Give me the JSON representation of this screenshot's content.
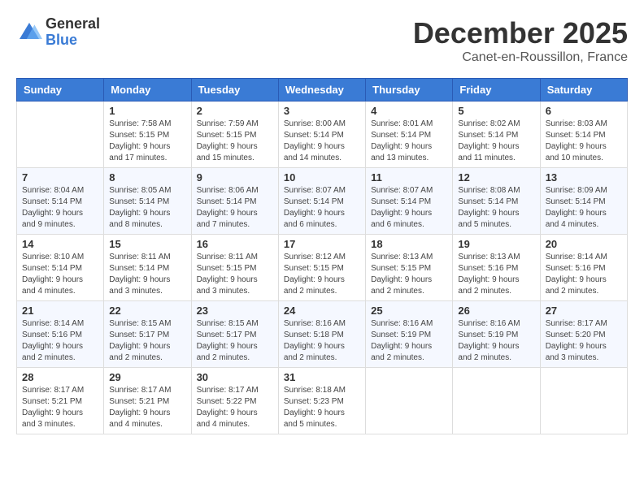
{
  "logo": {
    "general": "General",
    "blue": "Blue"
  },
  "title": "December 2025",
  "location": "Canet-en-Roussillon, France",
  "days_of_week": [
    "Sunday",
    "Monday",
    "Tuesday",
    "Wednesday",
    "Thursday",
    "Friday",
    "Saturday"
  ],
  "weeks": [
    [
      {
        "day": "",
        "sunrise": "",
        "sunset": "",
        "daylight": ""
      },
      {
        "day": "1",
        "sunrise": "Sunrise: 7:58 AM",
        "sunset": "Sunset: 5:15 PM",
        "daylight": "Daylight: 9 hours and 17 minutes."
      },
      {
        "day": "2",
        "sunrise": "Sunrise: 7:59 AM",
        "sunset": "Sunset: 5:15 PM",
        "daylight": "Daylight: 9 hours and 15 minutes."
      },
      {
        "day": "3",
        "sunrise": "Sunrise: 8:00 AM",
        "sunset": "Sunset: 5:14 PM",
        "daylight": "Daylight: 9 hours and 14 minutes."
      },
      {
        "day": "4",
        "sunrise": "Sunrise: 8:01 AM",
        "sunset": "Sunset: 5:14 PM",
        "daylight": "Daylight: 9 hours and 13 minutes."
      },
      {
        "day": "5",
        "sunrise": "Sunrise: 8:02 AM",
        "sunset": "Sunset: 5:14 PM",
        "daylight": "Daylight: 9 hours and 11 minutes."
      },
      {
        "day": "6",
        "sunrise": "Sunrise: 8:03 AM",
        "sunset": "Sunset: 5:14 PM",
        "daylight": "Daylight: 9 hours and 10 minutes."
      }
    ],
    [
      {
        "day": "7",
        "sunrise": "Sunrise: 8:04 AM",
        "sunset": "Sunset: 5:14 PM",
        "daylight": "Daylight: 9 hours and 9 minutes."
      },
      {
        "day": "8",
        "sunrise": "Sunrise: 8:05 AM",
        "sunset": "Sunset: 5:14 PM",
        "daylight": "Daylight: 9 hours and 8 minutes."
      },
      {
        "day": "9",
        "sunrise": "Sunrise: 8:06 AM",
        "sunset": "Sunset: 5:14 PM",
        "daylight": "Daylight: 9 hours and 7 minutes."
      },
      {
        "day": "10",
        "sunrise": "Sunrise: 8:07 AM",
        "sunset": "Sunset: 5:14 PM",
        "daylight": "Daylight: 9 hours and 6 minutes."
      },
      {
        "day": "11",
        "sunrise": "Sunrise: 8:07 AM",
        "sunset": "Sunset: 5:14 PM",
        "daylight": "Daylight: 9 hours and 6 minutes."
      },
      {
        "day": "12",
        "sunrise": "Sunrise: 8:08 AM",
        "sunset": "Sunset: 5:14 PM",
        "daylight": "Daylight: 9 hours and 5 minutes."
      },
      {
        "day": "13",
        "sunrise": "Sunrise: 8:09 AM",
        "sunset": "Sunset: 5:14 PM",
        "daylight": "Daylight: 9 hours and 4 minutes."
      }
    ],
    [
      {
        "day": "14",
        "sunrise": "Sunrise: 8:10 AM",
        "sunset": "Sunset: 5:14 PM",
        "daylight": "Daylight: 9 hours and 4 minutes."
      },
      {
        "day": "15",
        "sunrise": "Sunrise: 8:11 AM",
        "sunset": "Sunset: 5:14 PM",
        "daylight": "Daylight: 9 hours and 3 minutes."
      },
      {
        "day": "16",
        "sunrise": "Sunrise: 8:11 AM",
        "sunset": "Sunset: 5:15 PM",
        "daylight": "Daylight: 9 hours and 3 minutes."
      },
      {
        "day": "17",
        "sunrise": "Sunrise: 8:12 AM",
        "sunset": "Sunset: 5:15 PM",
        "daylight": "Daylight: 9 hours and 2 minutes."
      },
      {
        "day": "18",
        "sunrise": "Sunrise: 8:13 AM",
        "sunset": "Sunset: 5:15 PM",
        "daylight": "Daylight: 9 hours and 2 minutes."
      },
      {
        "day": "19",
        "sunrise": "Sunrise: 8:13 AM",
        "sunset": "Sunset: 5:16 PM",
        "daylight": "Daylight: 9 hours and 2 minutes."
      },
      {
        "day": "20",
        "sunrise": "Sunrise: 8:14 AM",
        "sunset": "Sunset: 5:16 PM",
        "daylight": "Daylight: 9 hours and 2 minutes."
      }
    ],
    [
      {
        "day": "21",
        "sunrise": "Sunrise: 8:14 AM",
        "sunset": "Sunset: 5:16 PM",
        "daylight": "Daylight: 9 hours and 2 minutes."
      },
      {
        "day": "22",
        "sunrise": "Sunrise: 8:15 AM",
        "sunset": "Sunset: 5:17 PM",
        "daylight": "Daylight: 9 hours and 2 minutes."
      },
      {
        "day": "23",
        "sunrise": "Sunrise: 8:15 AM",
        "sunset": "Sunset: 5:17 PM",
        "daylight": "Daylight: 9 hours and 2 minutes."
      },
      {
        "day": "24",
        "sunrise": "Sunrise: 8:16 AM",
        "sunset": "Sunset: 5:18 PM",
        "daylight": "Daylight: 9 hours and 2 minutes."
      },
      {
        "day": "25",
        "sunrise": "Sunrise: 8:16 AM",
        "sunset": "Sunset: 5:19 PM",
        "daylight": "Daylight: 9 hours and 2 minutes."
      },
      {
        "day": "26",
        "sunrise": "Sunrise: 8:16 AM",
        "sunset": "Sunset: 5:19 PM",
        "daylight": "Daylight: 9 hours and 2 minutes."
      },
      {
        "day": "27",
        "sunrise": "Sunrise: 8:17 AM",
        "sunset": "Sunset: 5:20 PM",
        "daylight": "Daylight: 9 hours and 3 minutes."
      }
    ],
    [
      {
        "day": "28",
        "sunrise": "Sunrise: 8:17 AM",
        "sunset": "Sunset: 5:21 PM",
        "daylight": "Daylight: 9 hours and 3 minutes."
      },
      {
        "day": "29",
        "sunrise": "Sunrise: 8:17 AM",
        "sunset": "Sunset: 5:21 PM",
        "daylight": "Daylight: 9 hours and 4 minutes."
      },
      {
        "day": "30",
        "sunrise": "Sunrise: 8:17 AM",
        "sunset": "Sunset: 5:22 PM",
        "daylight": "Daylight: 9 hours and 4 minutes."
      },
      {
        "day": "31",
        "sunrise": "Sunrise: 8:18 AM",
        "sunset": "Sunset: 5:23 PM",
        "daylight": "Daylight: 9 hours and 5 minutes."
      },
      {
        "day": "",
        "sunrise": "",
        "sunset": "",
        "daylight": ""
      },
      {
        "day": "",
        "sunrise": "",
        "sunset": "",
        "daylight": ""
      },
      {
        "day": "",
        "sunrise": "",
        "sunset": "",
        "daylight": ""
      }
    ]
  ]
}
